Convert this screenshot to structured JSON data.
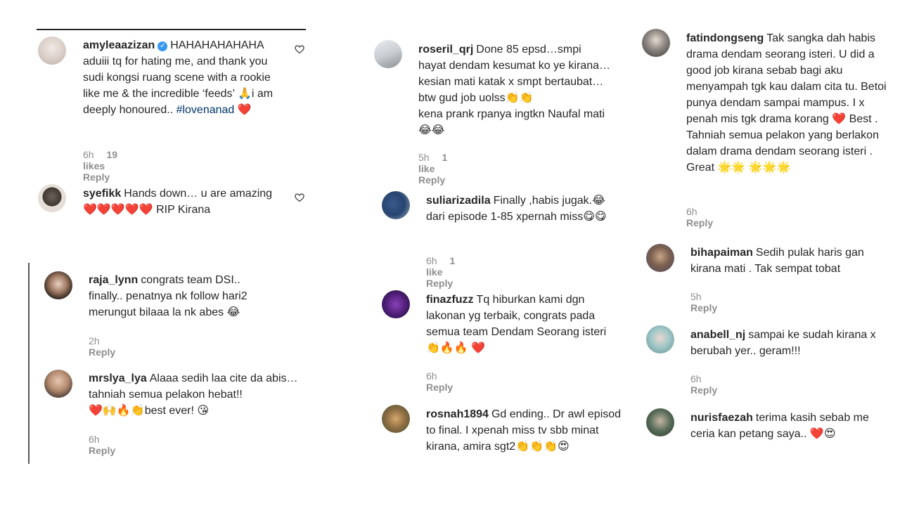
{
  "comments": [
    {
      "user": "amyleaazizan",
      "text": "HAHAHAHAHAHA aduiii tq for hating me, and thank you sudi kongsi ruang scene with a rookie like me & the incredible ‘feeds’ 🙏i am deeply honoured..",
      "hashtag": "#lovenanad",
      "emoji": "❤️",
      "time": "6h",
      "likes": "19 likes",
      "reply": "Reply"
    },
    {
      "user": "syefikk",
      "text": "Hands down… u are amazing",
      "emoji": "❤️❤️❤️❤️❤️",
      "text2": "RIP Kirana"
    },
    {
      "user": "raja_lynn",
      "text": "congrats team DSI.. finally.. penatnya nk follow hari2 merungut bilaaa la nk abes",
      "emoji": "😂",
      "time": "2h",
      "reply": "Reply"
    },
    {
      "user": "mrslya_lya",
      "text": "Alaaa sedih laa cite da abis…tahniah semua pelakon hebat!!",
      "emoji": "❤️🙌🔥👏",
      "text2": "best ever!",
      "emoji2": "😘",
      "time": "6h",
      "reply": "Reply"
    },
    {
      "user": "roseril_qrj",
      "text": "Done 85 epsd…smpi hayat dendam kesumat ko ye kirana…kesian mati katak x smpt bertaubat…btw gud job uolss",
      "emoji": "👏👏",
      "text2": "kena prank rpanya ingtkn Naufal mati",
      "emoji2": "😂😂",
      "time": "5h",
      "likes": "1 like",
      "reply": "Reply"
    },
    {
      "user": "suliarizadila",
      "text": "Finally ,habis jugak.",
      "emoji": "😂",
      "text2": "dari episode 1-85 xpernah miss",
      "emoji2": "😋😋",
      "time": "6h",
      "likes": "1 like",
      "reply": "Reply"
    },
    {
      "user": "finazfuzz",
      "text": "Tq hiburkan kami dgn lakonan yg terbaik, congrats pada semua team Dendam Seorang isteri",
      "emoji": "👏🔥🔥 ❤️",
      "time": "6h",
      "reply": "Reply"
    },
    {
      "user": "rosnah1894",
      "text": "Gd ending.. Dr awl episod to final. I xpenah miss tv sbb minat kirana, amira sgt2",
      "emoji": "👏👏👏😍",
      "time": "",
      "reply": ""
    },
    {
      "user": "fatindongseng",
      "text": "Tak sangka dah habis drama dendam seorang isteri. U did a good job kirana sebab bagi aku menyampah tgk kau dalam cita tu. Betoi punya dendam sampai mampus. I x penah mis tgk drama korang",
      "emoji": "❤️",
      "text2": "Best . Tahniah semua pelakon yang berlakon dalam drama dendam seorang isteri . Great",
      "emoji2": "🌟🌟 🌟🌟🌟",
      "time": "6h",
      "reply": "Reply"
    },
    {
      "user": "bihapaiman",
      "text": "Sedih pulak haris gan kirana mati . Tak sempat tobat",
      "time": "5h",
      "reply": "Reply"
    },
    {
      "user": "anabell_nj",
      "text": "sampai ke sudah kirana x berubah yer.. geram!!!",
      "time": "6h",
      "reply": "Reply"
    },
    {
      "user": "nurisfaezah",
      "text": "terima kasih sebab me ceria kan petang saya..",
      "emoji": "❤️😍"
    }
  ],
  "colors": {
    "text": "#262626",
    "muted": "#8e8e8e",
    "hashtag": "#00376b",
    "verified": "#3897f0"
  },
  "icons": [
    "heart-outline-icon",
    "verified-badge-icon"
  ]
}
